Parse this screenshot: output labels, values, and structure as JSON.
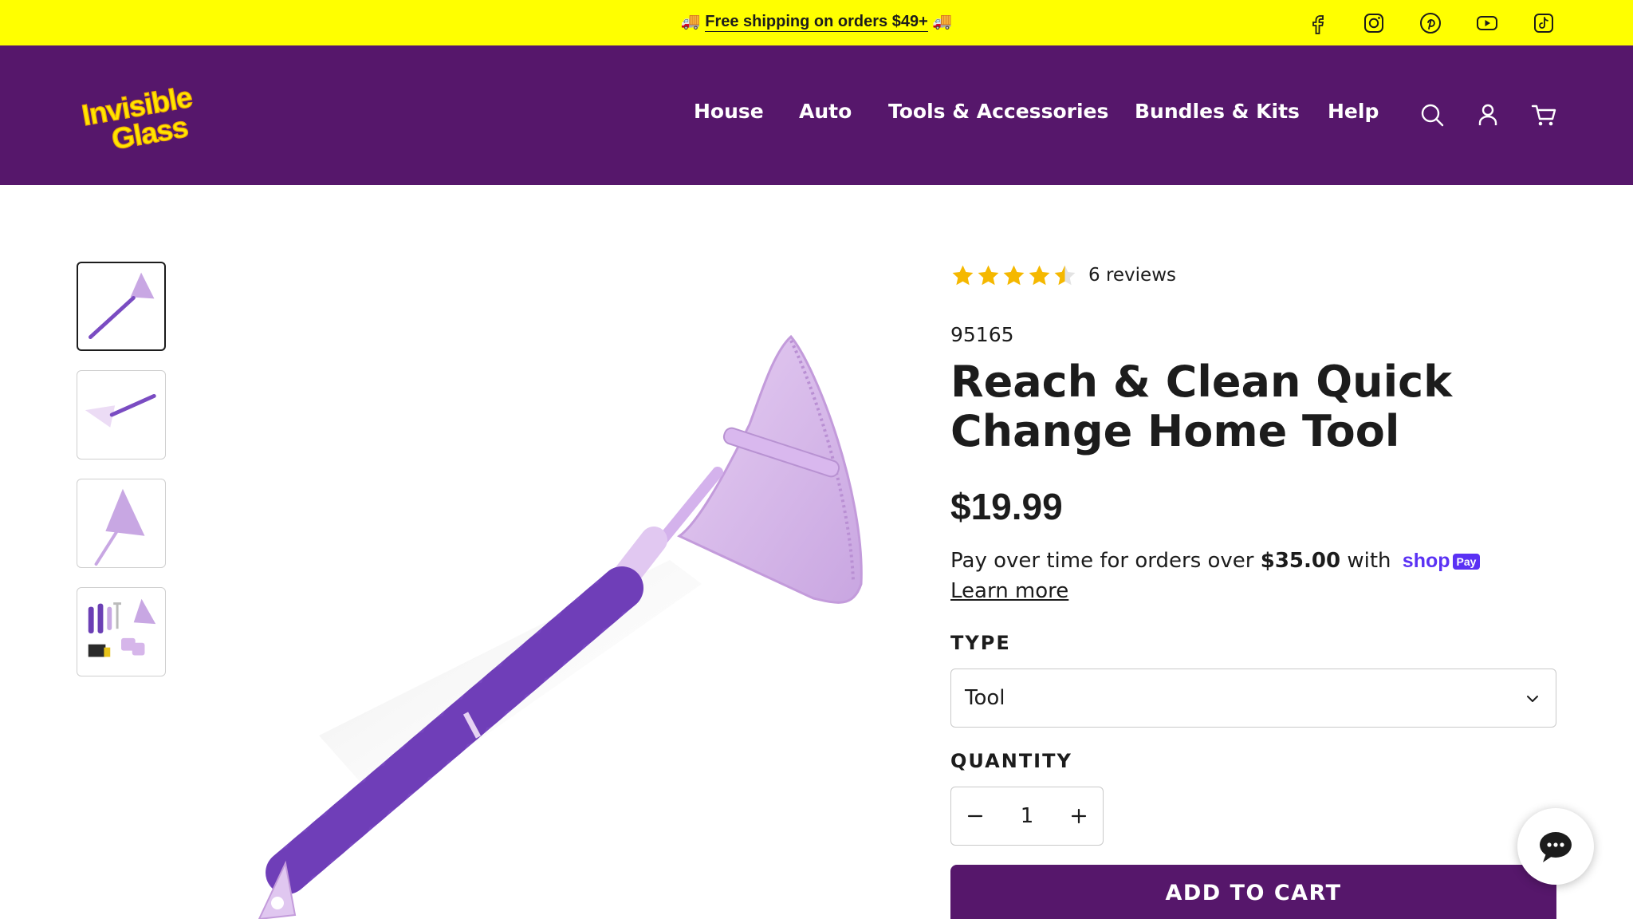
{
  "announcement": {
    "text": "Free shipping on orders $49+",
    "emoji_left": "🚚",
    "emoji_right": "🚚",
    "bg_color": "#ffff00"
  },
  "social_icons": [
    "facebook-icon",
    "instagram-icon",
    "pinterest-icon",
    "youtube-icon",
    "tiktok-icon"
  ],
  "header": {
    "bg_color": "#56176b",
    "logo_line1": "Invisible",
    "logo_line2": "Glass",
    "nav": [
      "House",
      "Auto",
      "Tools & Accessories",
      "Bundles & Kits",
      "Help"
    ],
    "icons": [
      "search-icon",
      "account-icon",
      "cart-icon"
    ]
  },
  "gallery": {
    "thumbnail_count": 4,
    "active_index": 0
  },
  "product": {
    "rating": 4.5,
    "rating_max": 5,
    "reviews_label": "6 reviews",
    "sku": "95165",
    "title": "Reach & Clean Quick Change Home Tool",
    "price": "$19.99",
    "pay_prefix": "Pay over time for orders over",
    "pay_amount": "$35.00",
    "pay_with": "with",
    "shop_word": "shop",
    "pay_badge": "Pay",
    "learn_more": "Learn more",
    "type_label": "TYPE",
    "type_value": "Tool",
    "quantity_label": "QUANTITY",
    "quantity": "1",
    "add_to_cart": "ADD TO CART"
  },
  "colors": {
    "brand_purple": "#56176b",
    "star_yellow": "#f5b800",
    "shop_pay": "#5a31f4"
  }
}
